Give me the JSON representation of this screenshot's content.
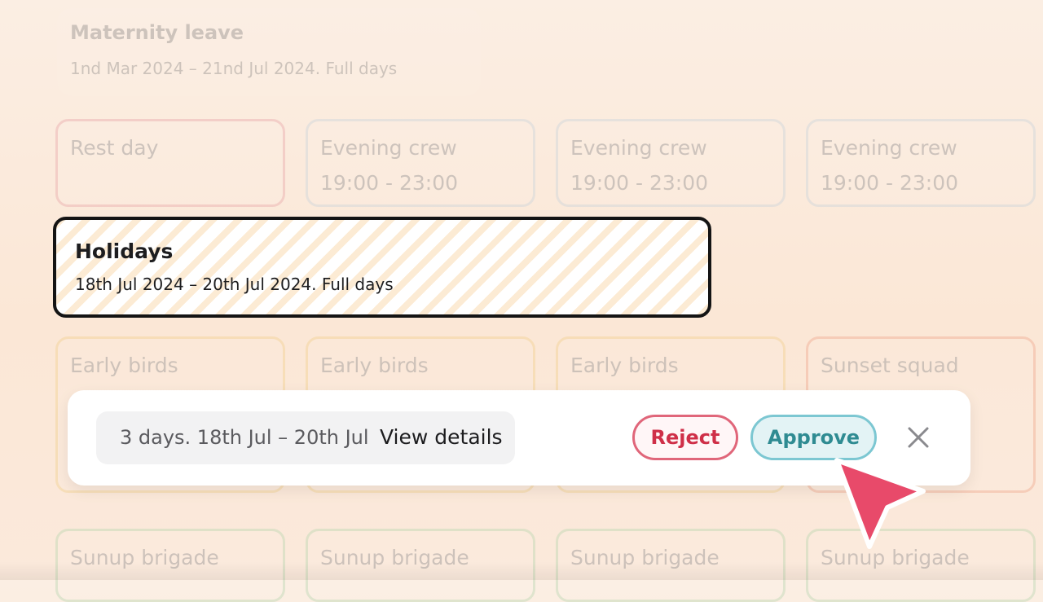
{
  "maternity": {
    "title": "Maternity leave",
    "dates": "1nd Mar 2024 – 21nd Jul 2024. Full days"
  },
  "shifts_row1": [
    {
      "name": "Rest day",
      "time": ""
    },
    {
      "name": "Evening crew",
      "time": "19:00 - 23:00"
    },
    {
      "name": "Evening crew",
      "time": "19:00 - 23:00"
    },
    {
      "name": "Evening crew",
      "time": "19:00 - 23:00"
    }
  ],
  "holidays": {
    "title": "Holidays",
    "dates": "18th Jul 2024 – 20th Jul 2024. Full days"
  },
  "shifts_row2": [
    {
      "name": "Early birds"
    },
    {
      "name": "Early birds"
    },
    {
      "name": "Early birds"
    },
    {
      "name": "Sunset squad"
    }
  ],
  "shifts_row3": [
    {
      "name": "Sunup brigade"
    },
    {
      "name": "Sunup brigade"
    },
    {
      "name": "Sunup brigade"
    },
    {
      "name": "Sunup brigade"
    }
  ],
  "action_bar": {
    "summary": "3 days. 18th Jul – 20th Jul",
    "view_details": "View details",
    "reject": "Reject",
    "approve": "Approve",
    "close_icon": "close-icon"
  },
  "colors": {
    "reject": "#cf2f48",
    "approve": "#2f8b92",
    "cursor": "#e84a6a"
  },
  "cursor_icon": "pointer-cursor-icon"
}
